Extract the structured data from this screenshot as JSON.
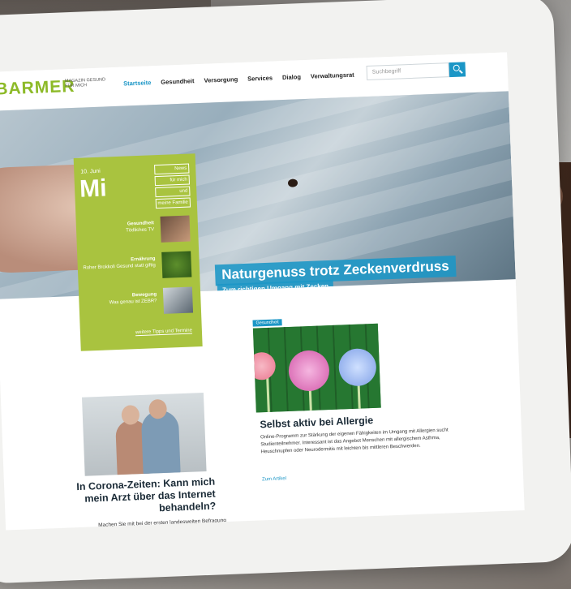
{
  "header": {
    "logo": "BARMER",
    "logo_sub": "MAGAZIN GESUND FÜR MICH",
    "nav": [
      "Startseite",
      "Gesundheit",
      "Versorgung",
      "Services",
      "Dialog",
      "Verwaltungsrat"
    ],
    "search_placeholder": "Suchbegriff"
  },
  "hero": {
    "headline": "Naturgenuss trotz Zeckenverdruss",
    "subline": "Zum richtigen Umgang mit Zecken"
  },
  "panel": {
    "date": "10. Juni",
    "day": "Mi",
    "tag_lines": [
      "News",
      "für mich",
      "und",
      "meine Familie"
    ],
    "items": [
      {
        "title": "Gesundheit",
        "text": "Tödliches TV"
      },
      {
        "title": "Ernährung",
        "text": "Roher Brokkoli Gesund statt giftig"
      },
      {
        "title": "Bewegung",
        "text": "Was genau ist ZEBR?"
      }
    ],
    "more": "weitere Tipps und Termine"
  },
  "article1": {
    "title": "In Corona-Zeiten: Kann mich mein Arzt über das Internet behandeln?",
    "text": "Machen Sie mit bei der ersten landesweiten Befragung"
  },
  "article2": {
    "badge": "Gesundheit",
    "title": "Selbst aktiv bei Allergie",
    "text": "Online-Programm zur Stärkung der eigenen Fähigkeiten im Umgang mit Allergien sucht Studienteilnehmer. Interessant ist das Angebot Menschen mit allergischem Asthma, Heuschnupfen oder Neurodermitis mit leichten bis mittleren Beschwerden.",
    "link": "Zum Artikel"
  },
  "colors": {
    "brand_green": "#8dba28",
    "panel_green": "#a9c33f",
    "accent_blue": "#1b96c6"
  }
}
